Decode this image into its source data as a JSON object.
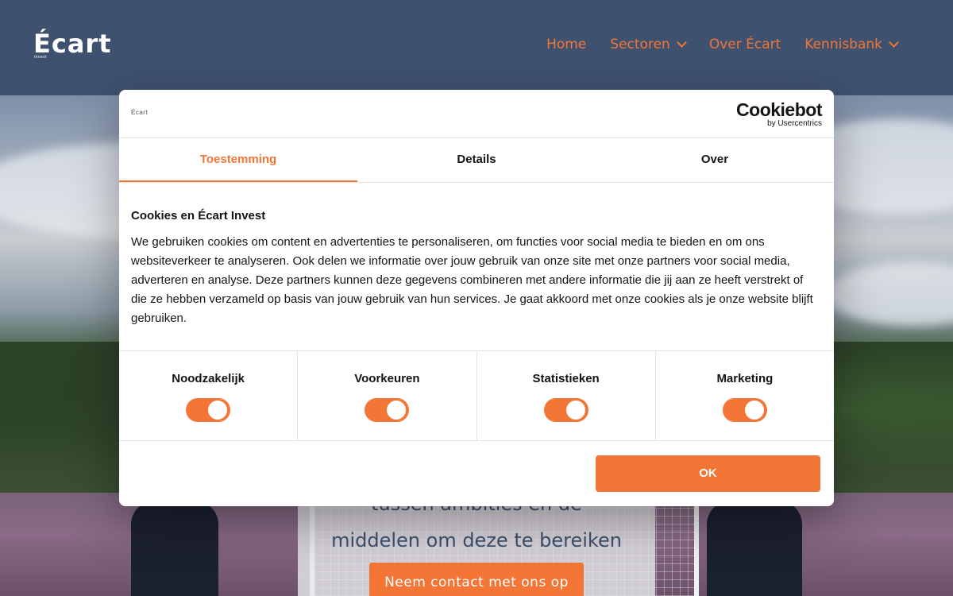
{
  "header": {
    "logo": "Écart",
    "logo_sub": "invest",
    "nav": [
      {
        "label": "Home"
      },
      {
        "label": "Sectoren"
      },
      {
        "label": "Over Écart"
      },
      {
        "label": "Kennisbank"
      }
    ]
  },
  "hero": {
    "line1": "tussen ambities en de",
    "line2": "middelen om deze te bereiken",
    "cta": "Neem contact met ons op"
  },
  "cookie_dialog": {
    "brand": "Écart",
    "cookiebot_name": "Cookiebot",
    "cookiebot_sub": "by Usercentrics",
    "tabs": [
      {
        "label": "Toestemming",
        "active": true
      },
      {
        "label": "Details",
        "active": false
      },
      {
        "label": "Over",
        "active": false
      }
    ],
    "title": "Cookies en Écart Invest",
    "body": "We gebruiken cookies om content en advertenties te personaliseren, om functies voor social media te bieden en om ons websiteverkeer te analyseren. Ook delen we informatie over jouw gebruik van onze site met onze partners voor social media, adverteren en analyse. Deze partners kunnen deze gegevens combineren met andere informatie die jij aan ze heeft verstrekt of die ze hebben verzameld op basis van jouw gebruik van hun services. Je gaat akkoord met onze cookies als je onze website blijft gebruiken.",
    "toggles": [
      {
        "label": "Noodzakelijk",
        "on": true
      },
      {
        "label": "Voorkeuren",
        "on": true
      },
      {
        "label": "Statistieken",
        "on": true
      },
      {
        "label": "Marketing",
        "on": true
      }
    ],
    "ok_label": "OK"
  },
  "colors": {
    "accent": "#f37636",
    "header_bg": "#3e516e",
    "text": "#141414"
  }
}
